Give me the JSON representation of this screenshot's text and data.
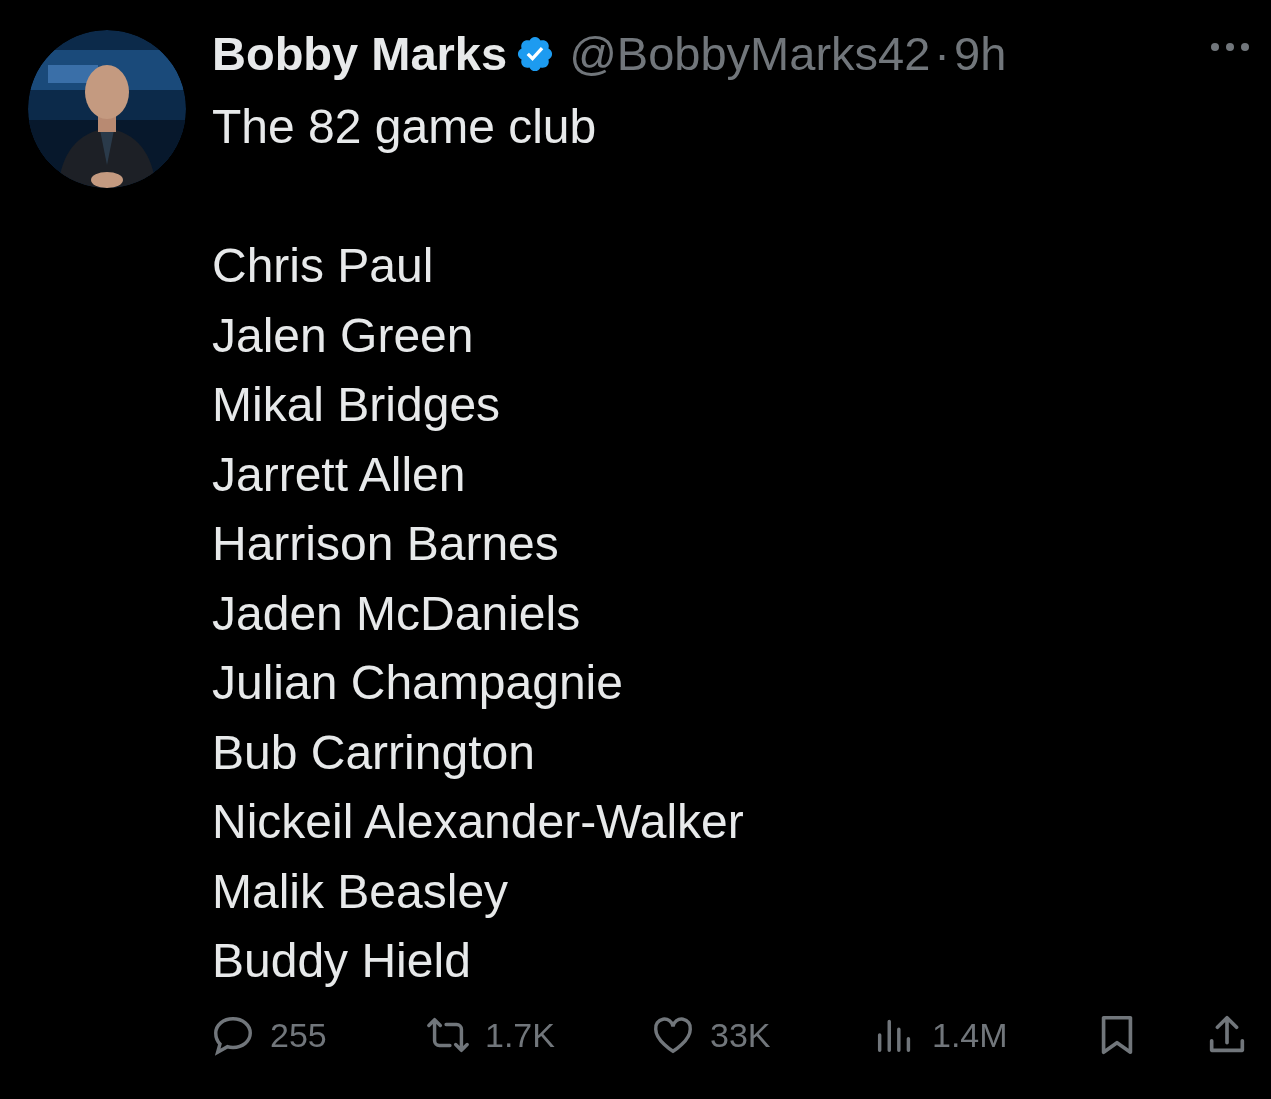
{
  "author": {
    "name": "Bobby Marks",
    "verified": true,
    "handle": "@BobbyMarks42",
    "separator": "·",
    "time": "9h"
  },
  "text": {
    "intro": "The 82 game club",
    "names": [
      "Chris Paul",
      "Jalen Green",
      "Mikal Bridges",
      "Jarrett Allen",
      "Harrison Barnes",
      "Jaden McDaniels",
      "Julian Champagnie",
      "Bub Carrington",
      "Nickeil Alexander-Walker",
      "Malik Beasley",
      "Buddy Hield"
    ]
  },
  "actions": [
    {
      "kind": "reply",
      "count": "255"
    },
    {
      "kind": "repost",
      "count": "1.7K"
    },
    {
      "kind": "like",
      "count": "33K"
    },
    {
      "kind": "views",
      "count": "1.4M"
    },
    {
      "kind": "bookmark"
    },
    {
      "kind": "share"
    }
  ]
}
